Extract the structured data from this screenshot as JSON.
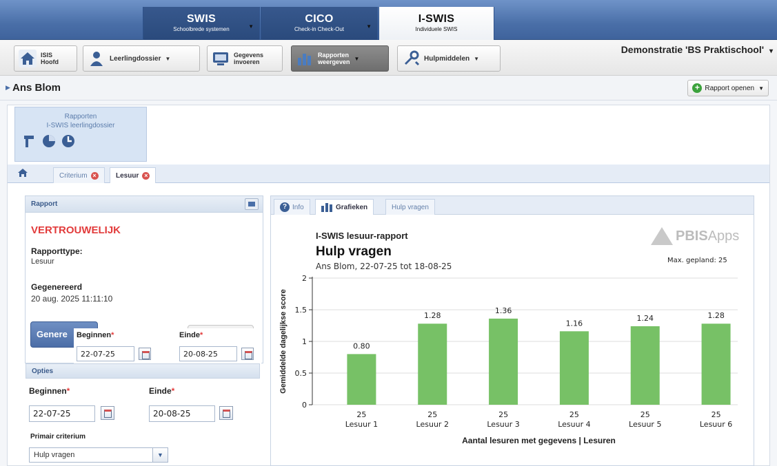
{
  "top_nav": {
    "tabs": [
      {
        "title": "SWIS",
        "subtitle": "Schoolbrede systemen"
      },
      {
        "title": "CICO",
        "subtitle": "Check-in Check-Out"
      },
      {
        "title": "I-SWIS",
        "subtitle": "Individuele SWIS"
      }
    ]
  },
  "toolbar": {
    "home_l1": "ISIS",
    "home_l2": "Hoofd",
    "dossier": "Leerlingdossier",
    "invoer_l1": "Gegevens",
    "invoer_l2": "invoeren",
    "rapport_l1": "Rapporten",
    "rapport_l2": "weergeven",
    "hulp": "Hulpmiddelen",
    "school": "Demonstratie 'BS Praktischool'"
  },
  "student": {
    "name": "Ans Blom",
    "open_report": "Rapport openen"
  },
  "reports_box": {
    "line1": "Rapporten",
    "line2": "I-SWIS leerlingdossier"
  },
  "tabs": [
    {
      "label": "Criterium"
    },
    {
      "label": "Lesuur"
    }
  ],
  "report_panel": {
    "header": "Rapport",
    "confidential": "VERTROUWELIJK",
    "type_label": "Rapporttype:",
    "type_value": "Lesuur",
    "generated_label": "Gegenereerd",
    "generated_value": "20 aug. 2025 11:11:10",
    "generate_button": "Genere"
  },
  "overlay": {
    "begin_label": "Beginnen",
    "begin_value": "22-07-25",
    "end_label": "Einde",
    "end_value": "20-08-25"
  },
  "options": {
    "header": "Opties",
    "begin_label": "Beginnen",
    "begin_value": "22-07-25",
    "end_label": "Einde",
    "end_value": "20-08-25",
    "criterion_label": "Primair criterium",
    "criterion_value": "Hulp vragen"
  },
  "right_tabs": [
    {
      "label": "Info"
    },
    {
      "label": "Grafieken"
    },
    {
      "label": "Hulp vragen"
    }
  ],
  "chart_header": {
    "report_name": "I-SWIS lesuur-rapport",
    "title": "Hulp vragen",
    "subtitle": "Ans Blom,  22-07-25 tot 18-08-25",
    "logo_main": "PBIS",
    "logo_apps": "Apps",
    "max_planned": "Max. gepland: 25"
  },
  "chart_data": {
    "type": "bar",
    "categories": [
      "Lesuur 1",
      "Lesuur 2",
      "Lesuur 3",
      "Lesuur 4",
      "Lesuur 5",
      "Lesuur 6"
    ],
    "counts": [
      "25",
      "25",
      "25",
      "25",
      "25",
      "25"
    ],
    "values": [
      0.8,
      1.28,
      1.36,
      1.16,
      1.24,
      1.28
    ],
    "value_labels": [
      "0.80",
      "1.28",
      "1.36",
      "1.16",
      "1.24",
      "1.28"
    ],
    "yticks": [
      "0",
      "0.5",
      "1",
      "1.5",
      "2"
    ],
    "ylim": [
      0,
      2
    ],
    "ylabel": "Gemiddelde dagelijkse score",
    "xlabel": "Aantal lesuren met gegevens | Lesuren",
    "bar_color": "#77c166",
    "grid": true
  }
}
